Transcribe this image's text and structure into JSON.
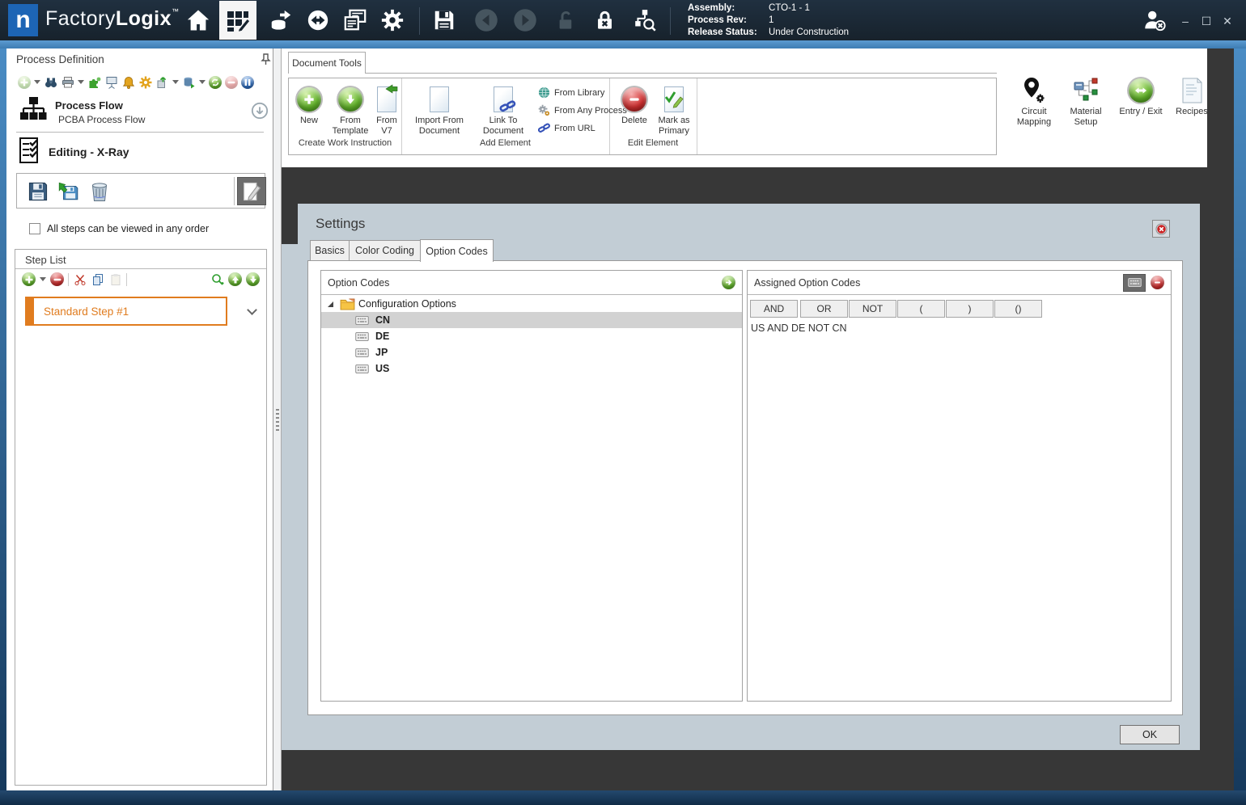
{
  "titlebar": {
    "brand_light": "Factory",
    "brand_bold": "Logix",
    "trademark": "™",
    "info": {
      "assembly_label": "Assembly:",
      "assembly_value": "CTO-1 - 1",
      "process_rev_label": "Process Rev:",
      "process_rev_value": "1",
      "release_status_label": "Release Status:",
      "release_status_value": "Under Construction"
    },
    "window_controls": {
      "minimize": "–",
      "maximize": "☐",
      "close": "✕"
    }
  },
  "left_panel": {
    "title": "Process Definition",
    "process_flow": {
      "title": "Process Flow",
      "subtitle": "PCBA Process Flow"
    },
    "editing_title": "Editing - X-Ray",
    "order_checkbox_label": "All steps can be viewed in any order",
    "step_list": {
      "title": "Step List",
      "steps": [
        {
          "label": "Standard Step #1"
        }
      ]
    }
  },
  "ribbon": {
    "tab": "Document Tools",
    "groups": [
      {
        "label": "Create Work Instruction",
        "items": [
          {
            "label": "New"
          },
          {
            "label": "From Template"
          },
          {
            "label": "From V7"
          }
        ]
      },
      {
        "label": "Add Element",
        "items": [
          {
            "label": "Import From Document"
          },
          {
            "label": "Link To Document"
          }
        ],
        "links": [
          {
            "label": "From Library"
          },
          {
            "label": "From Any Process"
          },
          {
            "label": "From URL"
          }
        ]
      },
      {
        "label": "Edit Element",
        "items": [
          {
            "label": "Delete"
          },
          {
            "label": "Mark as Primary"
          }
        ]
      }
    ],
    "tools": [
      {
        "label": "Circuit Mapping"
      },
      {
        "label": "Material Setup"
      },
      {
        "label": "Entry / Exit"
      },
      {
        "label": "Recipes"
      }
    ]
  },
  "dialog": {
    "title": "Settings",
    "tabs": [
      {
        "label": "Basics"
      },
      {
        "label": "Color Coding"
      },
      {
        "label": "Option Codes"
      }
    ],
    "active_tab": "Option Codes",
    "option_codes": {
      "title": "Option Codes",
      "root_label": "Configuration Options",
      "items": [
        {
          "label": "CN"
        },
        {
          "label": "DE"
        },
        {
          "label": "JP"
        },
        {
          "label": "US"
        }
      ],
      "selected": "CN"
    },
    "assigned": {
      "title": "Assigned Option Codes",
      "operators": [
        {
          "label": "AND"
        },
        {
          "label": "OR"
        },
        {
          "label": "NOT"
        },
        {
          "label": "("
        },
        {
          "label": ")"
        },
        {
          "label": "()"
        }
      ],
      "expression": "US AND DE NOT CN"
    },
    "ok_label": "OK"
  },
  "colors": {
    "accent_orange": "#E07C1F",
    "titlebar_bg": "#18242F",
    "window_border_blue": "#4A8CC4",
    "dialog_bg": "#C2CDD5",
    "action_green": "#4CA428",
    "delete_red": "#C62828",
    "logo_blue": "#1D65B5"
  }
}
